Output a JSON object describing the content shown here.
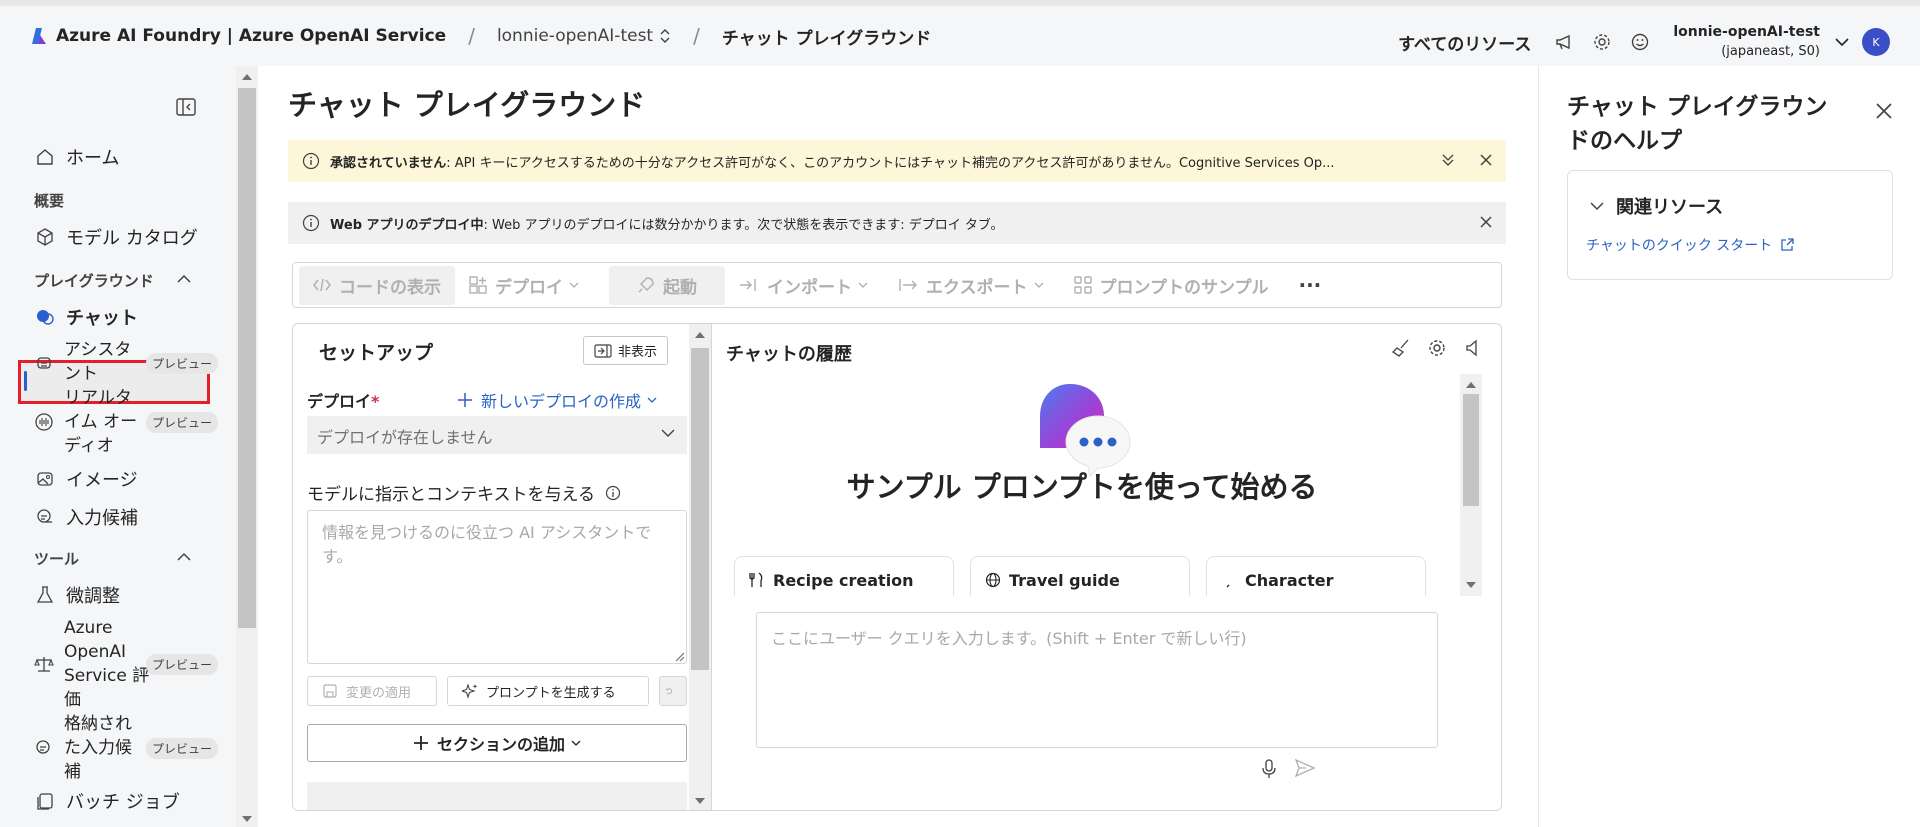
{
  "header": {
    "brand": "Azure AI Foundry | Azure OpenAI Service",
    "resource": "lonnie-openAI-test",
    "page": "チャット プレイグラウンド",
    "all_resources": "すべてのリソース",
    "user_name": "lonnie-openAI-test",
    "user_sub": "(japaneast, S0)",
    "avatar": "K"
  },
  "sidebar": {
    "home": "ホーム",
    "overview": "概要",
    "model_catalog": "モデル カタログ",
    "playground": "プレイグラウンド",
    "chat": "チャット",
    "assistant": "アシスタ\nント",
    "realtime": "リアルタ\nイム オー\nディオ",
    "image": "イメージ",
    "completions": "入力候補",
    "tools": "ツール",
    "finetune": "微調整",
    "eval": "Azure\nOpenAI\nService 評\n価",
    "stored": "格納され\nた入力候\n補",
    "batch": "バッチ ジョブ",
    "preview": "プレビュー"
  },
  "main": {
    "title": "チャット プレイグラウンド",
    "warn_bold": "承認されていません",
    "warn_text": ": API キーにアクセスするための十分なアクセス許可がなく、このアカウントにはチャット補完のアクセス許可がありません。Cognitive Services Op...",
    "info_bold": "Web アプリのデプロイ中",
    "info_text": ": Web アプリのデプロイには数分かかります。次で状態を表示できます: デプロイ タブ。",
    "toolbar": {
      "code": "コードの表示",
      "deploy": "デプロイ",
      "launch": "起動",
      "import": "インポート",
      "export": "エクスポート",
      "samples": "プロンプトのサンプル",
      "more": "···"
    }
  },
  "setup": {
    "title": "セットアップ",
    "hide": "非表示",
    "deploy_label": "デプロイ",
    "required": "*",
    "new_deploy": "新しいデプロイの作成",
    "no_deploy": "デプロイが存在しません",
    "sys_label": "モデルに指示とコンテキストを与える",
    "sys_placeholder": "情報を見つけるのに役立つ AI アシスタントです。",
    "apply": "変更の適用",
    "generate": "プロンプトを生成する",
    "add_section": "セクションの追加"
  },
  "chat": {
    "title": "チャットの履歴",
    "headline": "サンプル プロンプトを使って始める",
    "cards": [
      "Recipe creation",
      "Travel guide",
      "Character"
    ],
    "input_placeholder": "ここにユーザー クエリを入力します。(Shift + Enter で新しい行)"
  },
  "help": {
    "title": "チャット プレイグラウンドのヘルプ",
    "related": "関連リソース",
    "link": "チャットのクイック スタート"
  }
}
